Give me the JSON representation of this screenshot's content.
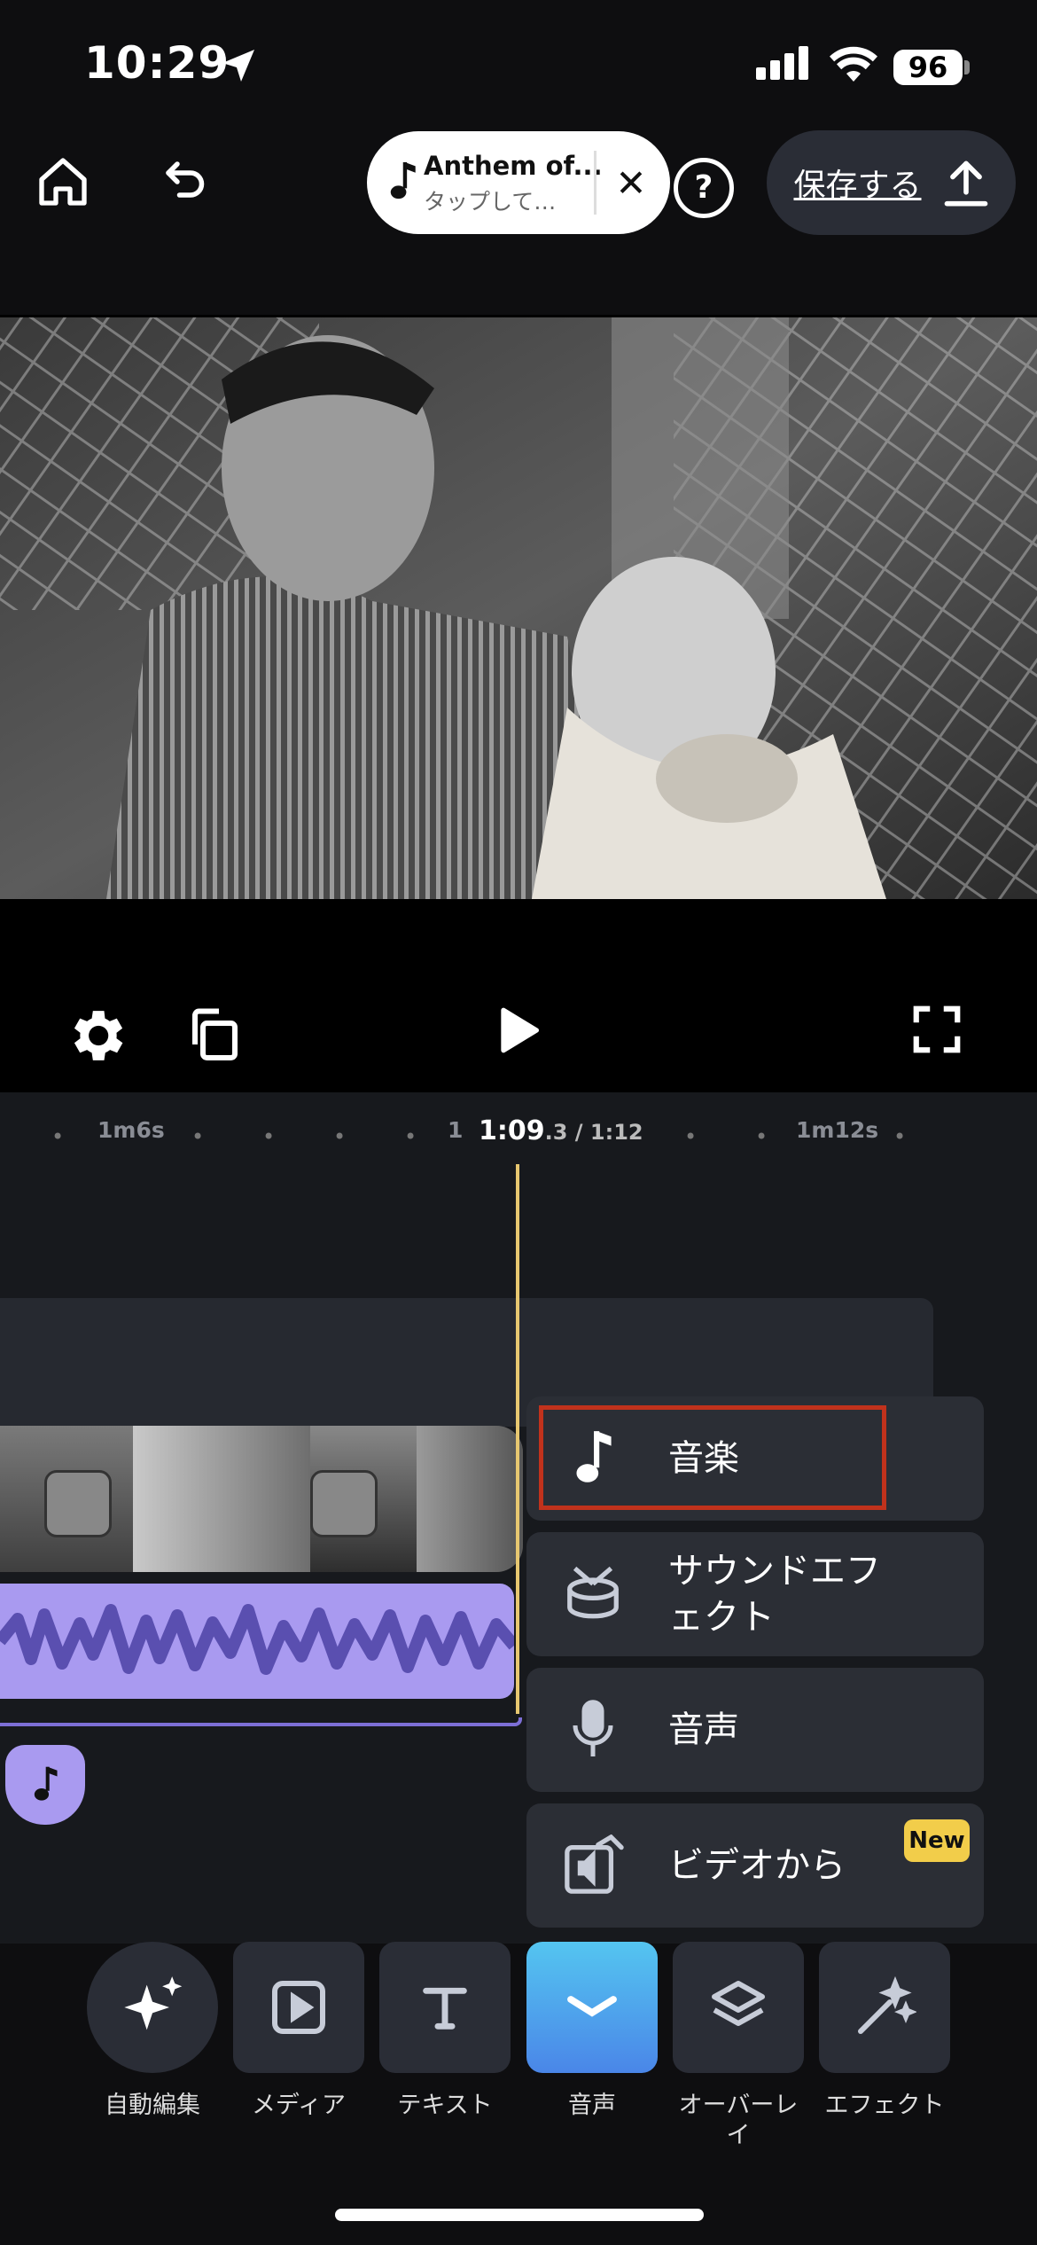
{
  "status": {
    "time": "10:29",
    "battery": "96"
  },
  "topbar": {
    "music_title": "Anthem of...",
    "music_sub": "タップして…",
    "close_glyph": "✕",
    "help_glyph": "?",
    "save_label": "保存する"
  },
  "timeline": {
    "ruler_left": "1m6s",
    "ruler_mid": "1",
    "current": "1:09",
    "current_frac": ".3 / 1:12",
    "ruler_right": "1m12s"
  },
  "menu": {
    "music": "音楽",
    "sfx": "サウンドエフェクト",
    "voice": "音声",
    "from_video": "ビデオから",
    "new_badge": "New"
  },
  "bottom": {
    "auto_edit": "自動編集",
    "media": "メディア",
    "text": "テキスト",
    "audio": "音声",
    "overlay": "オーバーレイ",
    "effect": "エフェクト"
  },
  "colors": {
    "accent": "#4fb5e6",
    "audio_track": "#a99af0",
    "highlight": "#c1321c",
    "badge": "#f2cd4a"
  }
}
